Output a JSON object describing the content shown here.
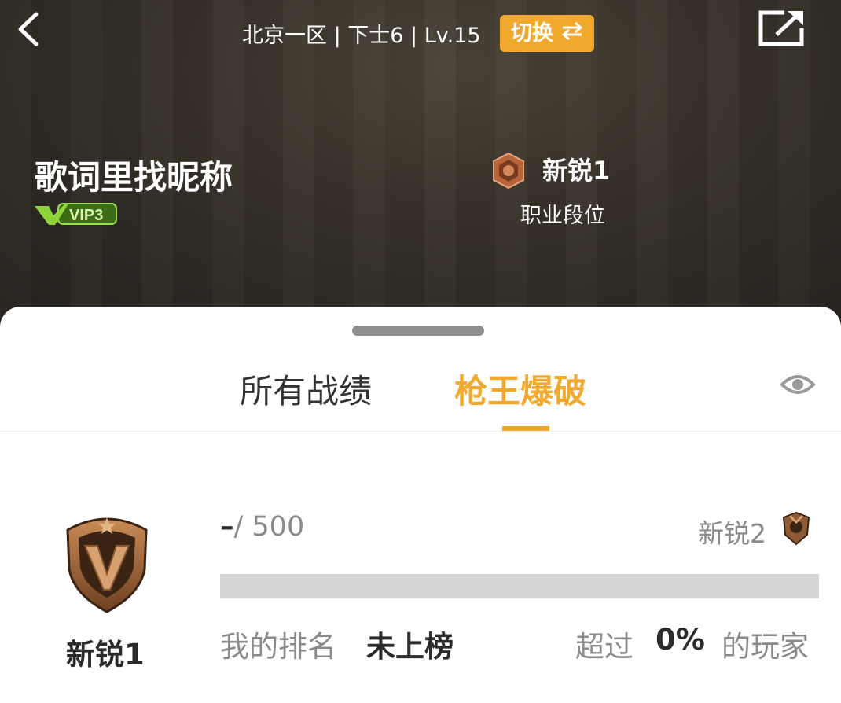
{
  "header": {
    "server_info": "北京一区 | 下士6 | Lv.15",
    "switch_label": "切换",
    "switch_icon": "swap-arrows-icon",
    "back_icon": "chevron-left-icon",
    "share_icon": "share-icon"
  },
  "profile": {
    "nickname": "歌词里找昵称",
    "vip_text": "VIP3",
    "rank_name": "新锐1",
    "rank_sub": "职业段位"
  },
  "tabs": [
    {
      "label": "所有战绩",
      "active": false
    },
    {
      "label": "枪王爆破",
      "active": true
    }
  ],
  "rank_panel": {
    "current_rank": "新锐1",
    "score_current": "–",
    "score_total": "/ 500",
    "progress_fraction": 0,
    "next_rank": "新锐2",
    "my_rank_label": "我的排名",
    "my_rank_value": "未上榜",
    "beat_label": "超过",
    "beat_value": "0%",
    "beat_suffix": "的玩家"
  },
  "colors": {
    "accent": "#f0a92c",
    "hero_bg": "#2c2822",
    "vip_green": "#7bc23c"
  }
}
